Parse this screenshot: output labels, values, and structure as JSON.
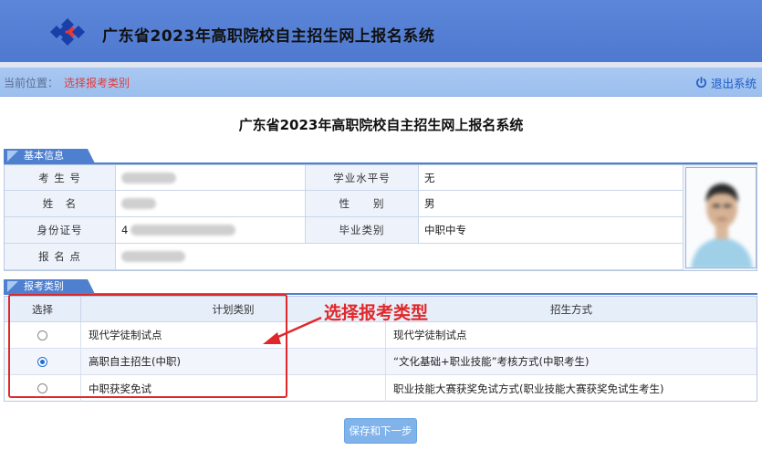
{
  "header": {
    "app_title": "广东省2023年高职院校自主招生网上报名系统",
    "logo_icon": "diamond-logo-icon"
  },
  "breadcrumb": {
    "label": "当前位置：",
    "current": "选择报考类别"
  },
  "logout": {
    "label": "退出系统",
    "icon": "power-icon"
  },
  "page_title": "广东省2023年高职院校自主招生网上报名系统",
  "basic_info": {
    "section_label": "基本信息",
    "exam_no_label": "考 生 号",
    "name_label": "姓　名",
    "id_label": "身份证号",
    "id_value_prefix": "4",
    "site_label": "报 名 点",
    "level_label": "学业水平号",
    "level_value": "无",
    "gender_label": "性　　别",
    "gender_value": "男",
    "grad_label": "毕业类别",
    "grad_value": "中职中专"
  },
  "category": {
    "section_label": "报考类别",
    "headers": {
      "select": "选择",
      "plan": "计划类别",
      "method": "招生方式"
    },
    "rows": [
      {
        "plan": "现代学徒制试点",
        "method": "现代学徒制试点",
        "selected": false
      },
      {
        "plan": "高职自主招生(中职)",
        "method": "“文化基础+职业技能”考核方式(中职考生)",
        "selected": true
      },
      {
        "plan": "中职获奖免试",
        "method": "职业技能大赛获奖免试方式(职业技能大赛获奖免试生考生)",
        "selected": false
      }
    ]
  },
  "annotation": {
    "text": "选择报考类型"
  },
  "submit_label": "保存和下一步",
  "colors": {
    "header": "#5b86d9",
    "crumb_bar": "#a9c8f2",
    "section_tab": "#4f7fcf",
    "accent_red": "#e0282a",
    "button": "#7fb3ea"
  }
}
